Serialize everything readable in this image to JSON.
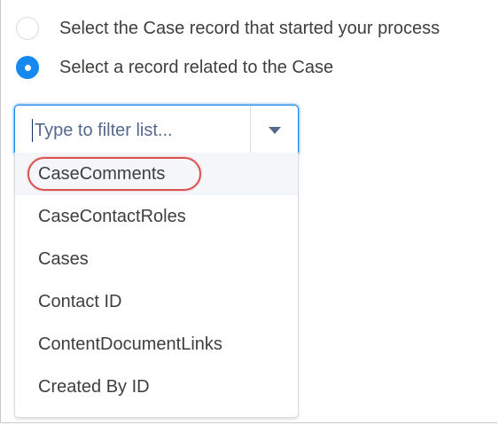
{
  "radio_options": [
    {
      "label": "Select the Case record that started your process",
      "checked": false
    },
    {
      "label": "Select a record related to the Case",
      "checked": true
    }
  ],
  "combobox": {
    "placeholder": "Type to filter list...",
    "value": ""
  },
  "dropdown": {
    "options": [
      "CaseComments",
      "CaseContactRoles",
      "Cases",
      "Contact ID",
      "ContentDocumentLinks",
      "Created By ID"
    ],
    "highlighted_index": 0
  },
  "colors": {
    "accent": "#1589ee",
    "focus_ring": "#0070d2",
    "annotation": "#d9534f",
    "text": "#3e3e3c",
    "placeholder": "#54698d"
  }
}
